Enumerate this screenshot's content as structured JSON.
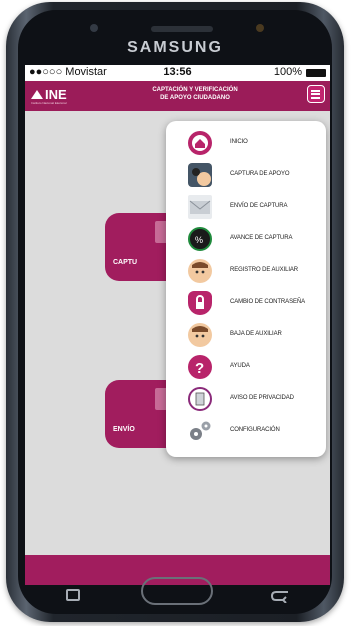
{
  "device": {
    "brand": "SAMSUNG"
  },
  "status_bar": {
    "carrier": "●●○○○ Movistar ",
    "time": "13:56",
    "battery": "100%"
  },
  "app_bar": {
    "logo": "INE",
    "logo_subtitle": "Instituto Nacional Electoral",
    "title_line1": "CAPTACIÓN Y VERIFICACIÓN",
    "title_line2": "DE APOYO CIUDADANO"
  },
  "tiles": {
    "captura": "CAPTU",
    "envio": "ENVÍO"
  },
  "menu": {
    "items": [
      {
        "label": "INICIO",
        "icon": "home-icon",
        "color": "#b8246a"
      },
      {
        "label": "CAPTURA DE APOYO",
        "icon": "camera-face-icon",
        "color": "#445566"
      },
      {
        "label": "ENVÍO DE CAPTURA",
        "icon": "mail-icon",
        "color": "#9aa3ad"
      },
      {
        "label": "AVANCE DE CAPTURA",
        "icon": "progress-icon",
        "color": "#1f8a3c"
      },
      {
        "label": "REGISTRO DE AUXILIAR",
        "icon": "user-add-icon",
        "color": "#e4a87c"
      },
      {
        "label": "CAMBIO DE CONTRASEÑA",
        "icon": "lock-shield-icon",
        "color": "#b8246a"
      },
      {
        "label": "BAJA DE AUXILIAR",
        "icon": "user-remove-icon",
        "color": "#e4a87c"
      },
      {
        "label": "AYUDA",
        "icon": "help-icon",
        "color": "#b8246a"
      },
      {
        "label": "AVISO DE PRIVACIDAD",
        "icon": "document-icon",
        "color": "#8a2a7a"
      },
      {
        "label": "CONFIGURACIÓN",
        "icon": "gears-icon",
        "color": "#7b8088"
      }
    ]
  },
  "colors": {
    "brand": "#9b1c59",
    "accent": "#b8246a"
  }
}
